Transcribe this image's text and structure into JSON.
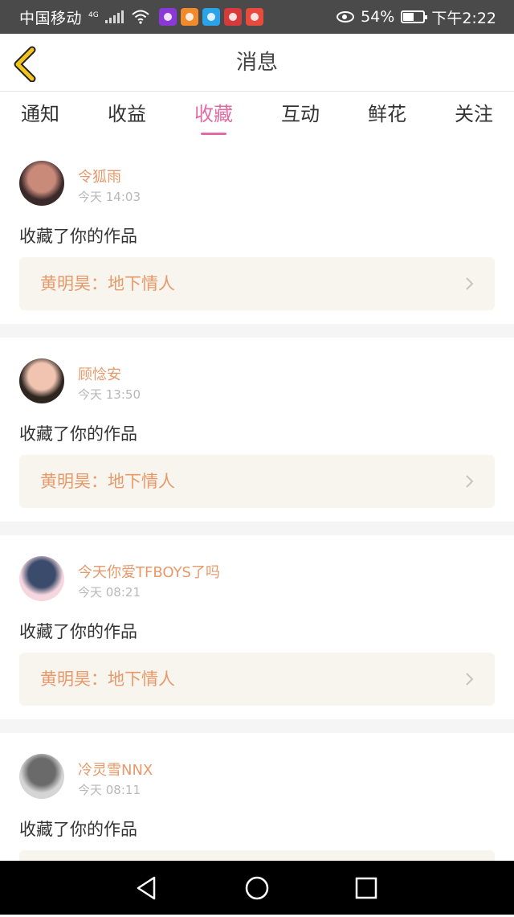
{
  "status_bar": {
    "carrier": "中国移动",
    "network": "4G",
    "battery_percent": "54%",
    "battery_level": 0.54,
    "time": "下午2:22",
    "app_icon_colors": [
      "#8a39d6",
      "#f08a2b",
      "#2aa3e8",
      "#d63a3a",
      "#e84b3c"
    ]
  },
  "header": {
    "title": "消息",
    "back_icon": "chevron-left-icon"
  },
  "tabs": [
    {
      "label": "通知",
      "active": false
    },
    {
      "label": "收益",
      "active": false
    },
    {
      "label": "收藏",
      "active": true
    },
    {
      "label": "互动",
      "active": false
    },
    {
      "label": "鲜花",
      "active": false
    },
    {
      "label": "关注",
      "active": false
    }
  ],
  "items": [
    {
      "user": "令狐雨",
      "time": "今天 14:03",
      "action": "收藏了你的作品",
      "work": "黄明昊：地下情人",
      "avatar_colors": [
        "#3b2a2a",
        "#c98a7a"
      ]
    },
    {
      "user": "顾惗安",
      "time": "今天 13:50",
      "action": "收藏了你的作品",
      "work": "黄明昊：地下情人",
      "avatar_colors": [
        "#2d2520",
        "#f0c4b0"
      ]
    },
    {
      "user": "今天你爱TFBOYS了吗",
      "time": "今天 08:21",
      "action": "收藏了你的作品",
      "work": "黄明昊：地下情人",
      "avatar_colors": [
        "#f7d7df",
        "#3a4b6b"
      ]
    },
    {
      "user": "冷灵雪NNX",
      "time": "今天 08:11",
      "action": "收藏了你的作品",
      "work": "",
      "avatar_colors": [
        "#d5d5d5",
        "#6a6a6a"
      ]
    }
  ],
  "colors": {
    "accent": "#e26ba4",
    "username": "#e8996a",
    "work_bg": "#f7f5ed",
    "back_icon": "#f2c51f"
  },
  "nav": [
    "back-triangle-icon",
    "home-circle-icon",
    "recents-square-icon"
  ]
}
